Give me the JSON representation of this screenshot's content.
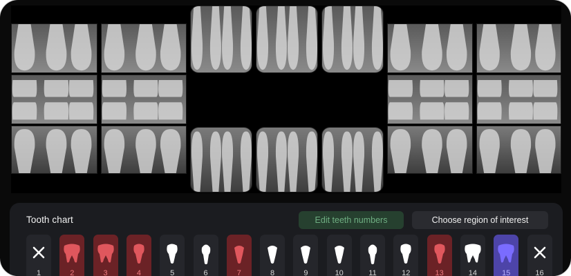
{
  "panel": {
    "title": "Tooth chart",
    "edit_button": "Edit teeth numbers",
    "roi_button": "Choose region of interest"
  },
  "colors": {
    "problem": "#e0575d",
    "selected": "#7a6cff",
    "normal": "#ffffff",
    "edit_button_text": "#6fae82"
  },
  "teeth": [
    {
      "number": "1",
      "status": "missing",
      "icon": "missing-tooth-icon",
      "shape": "x"
    },
    {
      "number": "2",
      "status": "problem",
      "icon": "molar-icon",
      "shape": "molar"
    },
    {
      "number": "3",
      "status": "problem",
      "icon": "molar-icon",
      "shape": "molar"
    },
    {
      "number": "4",
      "status": "problem",
      "icon": "premolar-icon",
      "shape": "premolar"
    },
    {
      "number": "5",
      "status": "normal",
      "icon": "premolar-icon",
      "shape": "premolar"
    },
    {
      "number": "6",
      "status": "normal",
      "icon": "canine-icon",
      "shape": "canine"
    },
    {
      "number": "7",
      "status": "problem",
      "icon": "incisor-icon",
      "shape": "incisor"
    },
    {
      "number": "8",
      "status": "normal",
      "icon": "incisor-icon",
      "shape": "incisor"
    },
    {
      "number": "9",
      "status": "normal",
      "icon": "incisor-icon",
      "shape": "incisor"
    },
    {
      "number": "10",
      "status": "normal",
      "icon": "incisor-icon",
      "shape": "incisor"
    },
    {
      "number": "11",
      "status": "normal",
      "icon": "canine-icon",
      "shape": "canine"
    },
    {
      "number": "12",
      "status": "normal",
      "icon": "premolar-icon",
      "shape": "premolar"
    },
    {
      "number": "13",
      "status": "problem",
      "icon": "premolar-icon",
      "shape": "premolar"
    },
    {
      "number": "14",
      "status": "normal",
      "icon": "molar-icon",
      "shape": "molar"
    },
    {
      "number": "15",
      "status": "selected",
      "icon": "molar-icon",
      "shape": "molar"
    },
    {
      "number": "16",
      "status": "missing",
      "icon": "missing-tooth-icon",
      "shape": "x"
    }
  ]
}
